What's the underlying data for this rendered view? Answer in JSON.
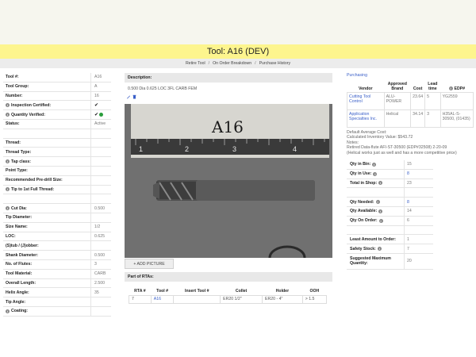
{
  "page": {
    "title": "Tool: A16 (DEV)",
    "breadcrumbs": [
      "Retire Tool",
      "On Order Breakdown",
      "Purchase History"
    ]
  },
  "properties": [
    {
      "label": "Tool #:",
      "value": "A16"
    },
    {
      "label": "Tool Group:",
      "value": "A"
    },
    {
      "label": "Number:",
      "value": "16"
    },
    {
      "label": "Inspection Certified:",
      "value": "✔",
      "info": true
    },
    {
      "label": "Quantity Verified:",
      "value": "✔",
      "info": true,
      "green": true
    },
    {
      "label": "Status:",
      "value": "Active"
    },
    {
      "label": "",
      "value": ""
    },
    {
      "label": "Thread:",
      "value": ""
    },
    {
      "label": "Thread Type:",
      "value": ""
    },
    {
      "label": "Tap class:",
      "value": "",
      "info": true
    },
    {
      "label": "Point Type:",
      "value": ""
    },
    {
      "label": "Recommended Pre-drill Size:",
      "value": ""
    },
    {
      "label": "Tip to 1st Full Thread:",
      "value": "",
      "info": true
    },
    {
      "label": "",
      "value": ""
    },
    {
      "label": "Cut Dia:",
      "value": "0.500",
      "info": true
    },
    {
      "label": "Tip Diameter:",
      "value": ""
    },
    {
      "label": "Size Name:",
      "value": "1/2"
    },
    {
      "label": "LOC:",
      "value": "0.625"
    },
    {
      "label": "(S)tub / (J)obber:",
      "value": ""
    },
    {
      "label": "Shank Diameter:",
      "value": "0.500"
    },
    {
      "label": "No. of Flutes:",
      "value": "3"
    },
    {
      "label": "Tool Material:",
      "value": "CARB"
    },
    {
      "label": "Overall Length:",
      "value": "2.500"
    },
    {
      "label": "Helix Angle:",
      "value": "35"
    },
    {
      "label": "Tip Angle:",
      "value": ""
    },
    {
      "label": "Coating:",
      "value": "",
      "info": true
    }
  ],
  "description": {
    "header": "Description:",
    "text": "0.500 Dia 0.625 LOC 3FL CARB FEM"
  },
  "photo": {
    "handwritten_label": "A16",
    "ruler_numbers": [
      "1",
      "2",
      "3",
      "4"
    ]
  },
  "add_picture_label": "+ ADD PICTURE",
  "rta": {
    "header": "Part of RTAs:",
    "columns": [
      "RTA #",
      "Tool #",
      "Insert Tool #",
      "Collet",
      "Holder",
      "OOH"
    ],
    "rows": [
      [
        "7",
        "A16",
        "",
        "ER20 1/2\"",
        "ER20 - 4\"",
        "> 1.5"
      ]
    ]
  },
  "purchasing": {
    "link": "Purchasing",
    "columns": [
      "Vendor",
      "Approved Brand",
      "Cost",
      "Lead time",
      "EDP#"
    ],
    "rows": [
      [
        "Cutting Tool Control",
        "ALU-POWER",
        "23.64",
        "5",
        "YG2559"
      ],
      [
        "Application Specialties Inc.",
        "Helical",
        "34.14",
        "3",
        "H35AL-S-30500, (01435)"
      ]
    ],
    "notes": [
      "Default Average Cost:",
      "Calculated Inventory Value: $543.72",
      "Notes:",
      "Retired Data-flute AFI-ST-30500 (EDP#32508) 2-20-09",
      "(Helical works just as well and has a more competitive price)"
    ]
  },
  "quantities": [
    {
      "label": "Qty in Bin:",
      "value": "15",
      "info": true
    },
    {
      "label": "Qty in Use:",
      "value": "8",
      "link": true,
      "info": true
    },
    {
      "label": "Total in Shop:",
      "value": "23",
      "info": true
    },
    {
      "label": "",
      "value": ""
    },
    {
      "label": "Qty Needed:",
      "value": "8",
      "link": true,
      "info": true
    },
    {
      "label": "Qty Available:",
      "value": "14",
      "info": true
    },
    {
      "label": "Qty On Order:",
      "value": "6",
      "info": true
    },
    {
      "label": "",
      "value": ""
    },
    {
      "label": "Least Amount to Order:",
      "value": "1"
    },
    {
      "label": "Safety Stock:",
      "value": "7",
      "info": true
    },
    {
      "label": "Suggested Maximum Quantity:",
      "value": "20",
      "tall": true
    }
  ]
}
